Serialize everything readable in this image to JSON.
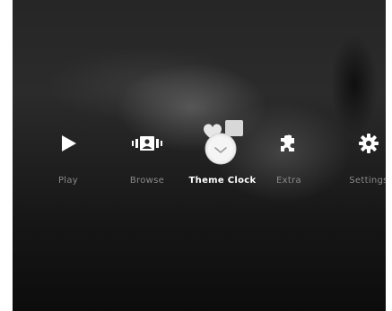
{
  "menu": {
    "items": [
      {
        "label": "Play",
        "icon": "play-icon",
        "selected": false
      },
      {
        "label": "Browse",
        "icon": "browse-photo-icon",
        "selected": false
      },
      {
        "label": "Theme Clock",
        "icon": "theme-clock-icon",
        "selected": true
      },
      {
        "label": "Extra",
        "icon": "extra-puzzle-icon",
        "selected": false
      },
      {
        "label": "Settings",
        "icon": "settings-gear-icon",
        "selected": false
      }
    ]
  },
  "colors": {
    "label_inactive": "#8a8a8a",
    "label_active": "#ffffff",
    "icon": "#ffffff"
  }
}
